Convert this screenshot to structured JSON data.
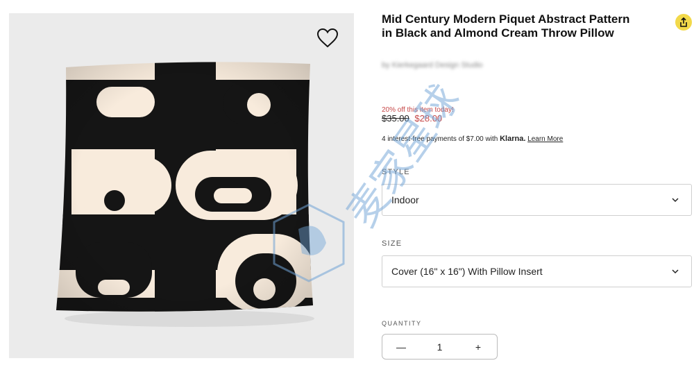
{
  "product": {
    "title": "Mid Century Modern Piquet Abstract Pattern in Black and Almond Cream Throw Pillow",
    "artist": "by Kierkegaard Design Studio"
  },
  "pricing": {
    "promo": "20% off this item today!",
    "original_price": "$35.00",
    "sale_price": "$28.00",
    "sale_color": "#c64848"
  },
  "klarna": {
    "text": "4 interest-free payments of $7.00 with",
    "brand": "Klarna.",
    "learn_more": "Learn More"
  },
  "style": {
    "label": "STYLE",
    "selected": "Indoor"
  },
  "size": {
    "label": "SIZE",
    "selected": "Cover (16\" x 16\") With Pillow Insert"
  },
  "quantity": {
    "label": "QUANTITY",
    "value": "1",
    "decrement": "—",
    "increment": "+"
  },
  "icons": {
    "favorite": "heart-icon",
    "share": "share-icon",
    "dropdown": "chevron-down-icon"
  },
  "watermark": {
    "text": "麦家星球"
  },
  "colors": {
    "pillow_black": "#151515",
    "pillow_cream": "#f8ebdc",
    "share_bg": "#f2d94a"
  }
}
